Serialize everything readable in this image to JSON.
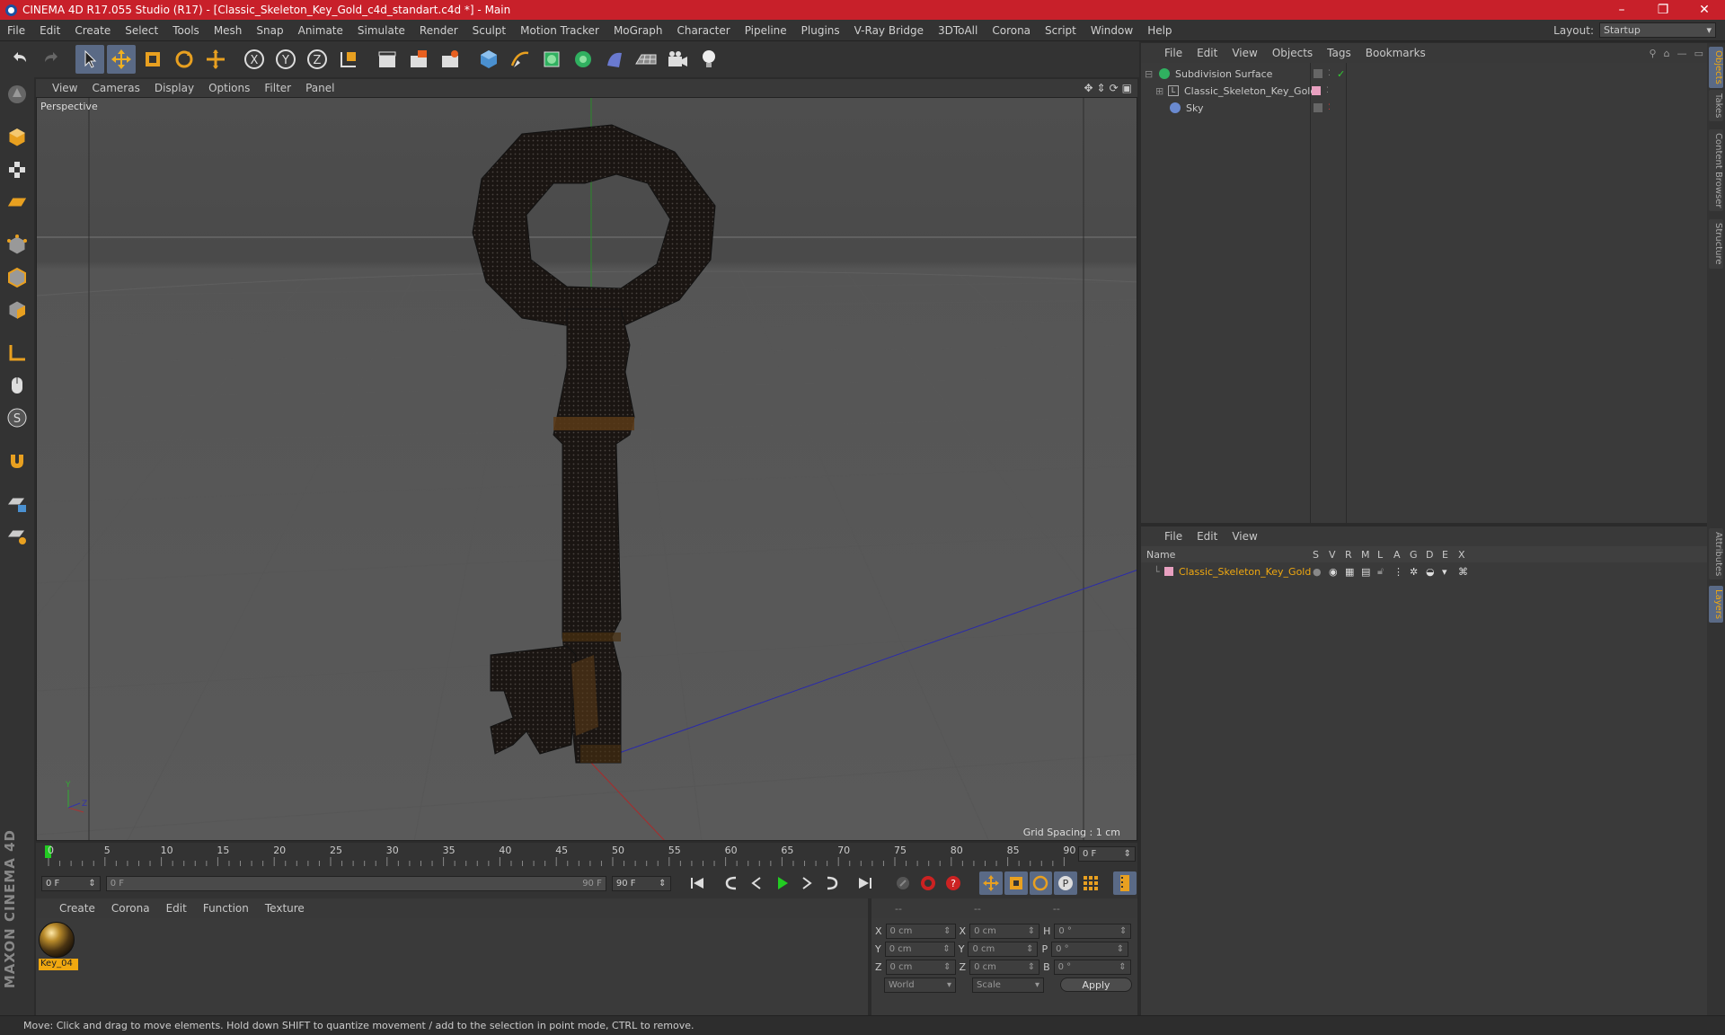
{
  "window": {
    "title": "CINEMA 4D R17.055 Studio (R17) - [Classic_Skeleton_Key_Gold_c4d_standart.c4d *] - Main",
    "controls": [
      "–",
      "❐",
      "✕"
    ]
  },
  "menubar": {
    "items": [
      "File",
      "Edit",
      "Create",
      "Select",
      "Tools",
      "Mesh",
      "Snap",
      "Animate",
      "Simulate",
      "Render",
      "Sculpt",
      "Motion Tracker",
      "MoGraph",
      "Character",
      "Pipeline",
      "Plugins",
      "V-Ray Bridge",
      "3DToAll",
      "Corona",
      "Script",
      "Window",
      "Help"
    ],
    "layout_label": "Layout:",
    "layout_value": "Startup"
  },
  "viewport": {
    "menu": [
      "View",
      "Cameras",
      "Display",
      "Options",
      "Filter",
      "Panel"
    ],
    "camera_label": "Perspective",
    "grid_spacing": "Grid Spacing : 1 cm"
  },
  "timeline": {
    "ticks": [
      "0",
      "5",
      "10",
      "15",
      "20",
      "25",
      "30",
      "35",
      "40",
      "45",
      "50",
      "55",
      "60",
      "65",
      "70",
      "75",
      "80",
      "85",
      "90"
    ],
    "current_frame": "0 F",
    "start_field": "0 F",
    "range_start": "0 F",
    "range_end": "90 F",
    "end_field": "90 F"
  },
  "material_panel": {
    "menu": [
      "Create",
      "Corona",
      "Edit",
      "Function",
      "Texture"
    ],
    "materials": [
      {
        "name": "Key_04"
      }
    ]
  },
  "coordinates": {
    "headers": [
      "--",
      "--",
      "--"
    ],
    "rows": [
      {
        "a": "X",
        "av": "0 cm",
        "b": "X",
        "bv": "0 cm",
        "c": "H",
        "cv": "0 °"
      },
      {
        "a": "Y",
        "av": "0 cm",
        "b": "Y",
        "bv": "0 cm",
        "c": "P",
        "cv": "0 °"
      },
      {
        "a": "Z",
        "av": "0 cm",
        "b": "Z",
        "bv": "0 cm",
        "c": "B",
        "cv": "0 °"
      }
    ],
    "mode": "World",
    "scale": "Scale",
    "apply": "Apply"
  },
  "objects_panel": {
    "menu": [
      "File",
      "Edit",
      "View",
      "Objects",
      "Tags",
      "Bookmarks"
    ],
    "items": [
      {
        "name": "Subdivision Surface"
      },
      {
        "name": "Classic_Skeleton_Key_Gold"
      },
      {
        "name": "Sky"
      }
    ]
  },
  "layers_panel": {
    "menu": [
      "File",
      "Edit",
      "View"
    ],
    "columns": [
      "Name",
      "S",
      "V",
      "R",
      "M",
      "L",
      "A",
      "G",
      "D",
      "E",
      "X"
    ],
    "items": [
      {
        "name": "Classic_Skeleton_Key_Gold"
      }
    ]
  },
  "side_tabs": [
    "Objects",
    "Takes",
    "Content Browser",
    "Structure",
    "Attributes",
    "Layers"
  ],
  "status": "Move: Click and drag to move elements. Hold down SHIFT to quantize movement / add to the selection in point mode, CTRL to remove.",
  "brand": "MAXON CINEMA 4D",
  "colors": {
    "title_bar": "#c8202a",
    "accent_orange": "#f0a810",
    "active_tool": "#5a6a86"
  }
}
